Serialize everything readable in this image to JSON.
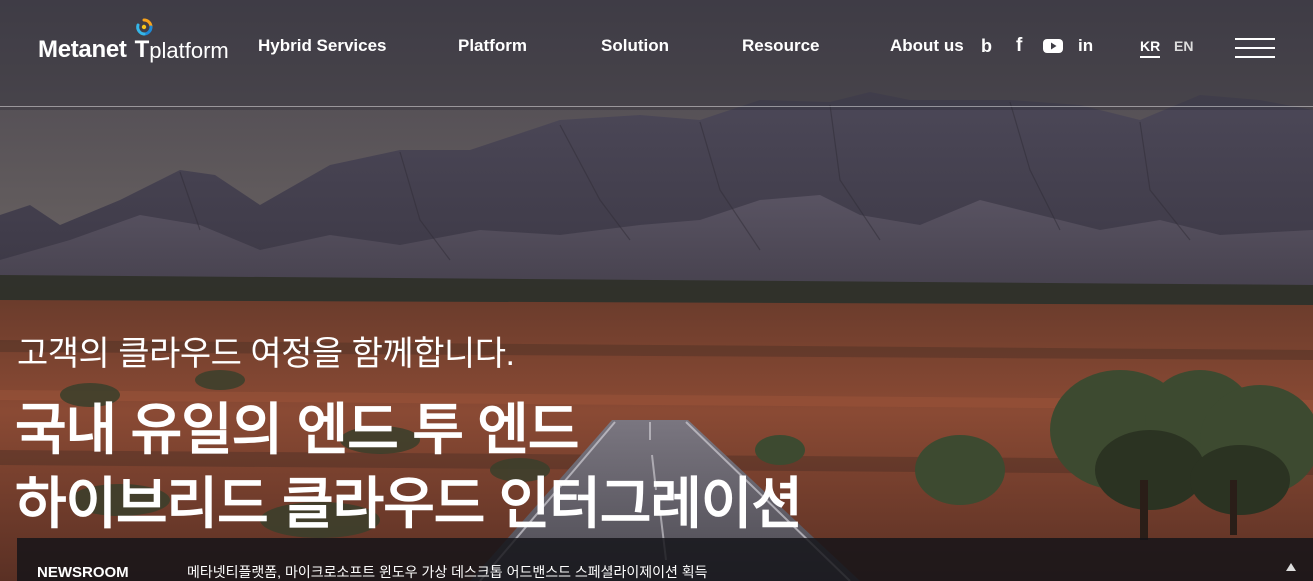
{
  "header": {
    "logo": {
      "brand": "Metanet",
      "t": "T",
      "platform": "platform"
    },
    "nav": [
      {
        "label": "Hybrid Services"
      },
      {
        "label": "Platform"
      },
      {
        "label": "Solution"
      },
      {
        "label": "Resource"
      },
      {
        "label": "About us"
      }
    ],
    "social": [
      {
        "icon": "blog-b-icon",
        "glyph": "b"
      },
      {
        "icon": "facebook-icon",
        "glyph": "f"
      },
      {
        "icon": "youtube-icon"
      },
      {
        "icon": "linkedin-icon",
        "glyph": "in"
      }
    ],
    "lang": {
      "kr": "KR",
      "en": "EN",
      "active": "KR"
    },
    "menu_icon": "hamburger-menu-icon"
  },
  "hero": {
    "subtitle": "고객의 클라우드 여정을 함께합니다.",
    "headline_line1": "국내 유일의 엔드 투 엔드",
    "headline_line2": "하이브리드 클라우드 인터그레이션"
  },
  "newsroom": {
    "label": "NEWSROOM",
    "headline": "메타넷티플랫폼, 마이크로소프트 윈도우 가상 데스크톱 어드밴스드 스페셜라이제이션 획득",
    "arrow_icon": "arrow-up-icon"
  },
  "colors": {
    "text": "#ffffff",
    "newsbar_bg": "#141418",
    "logo_orange": "#f7a21b",
    "logo_blue": "#1e8ad6"
  }
}
